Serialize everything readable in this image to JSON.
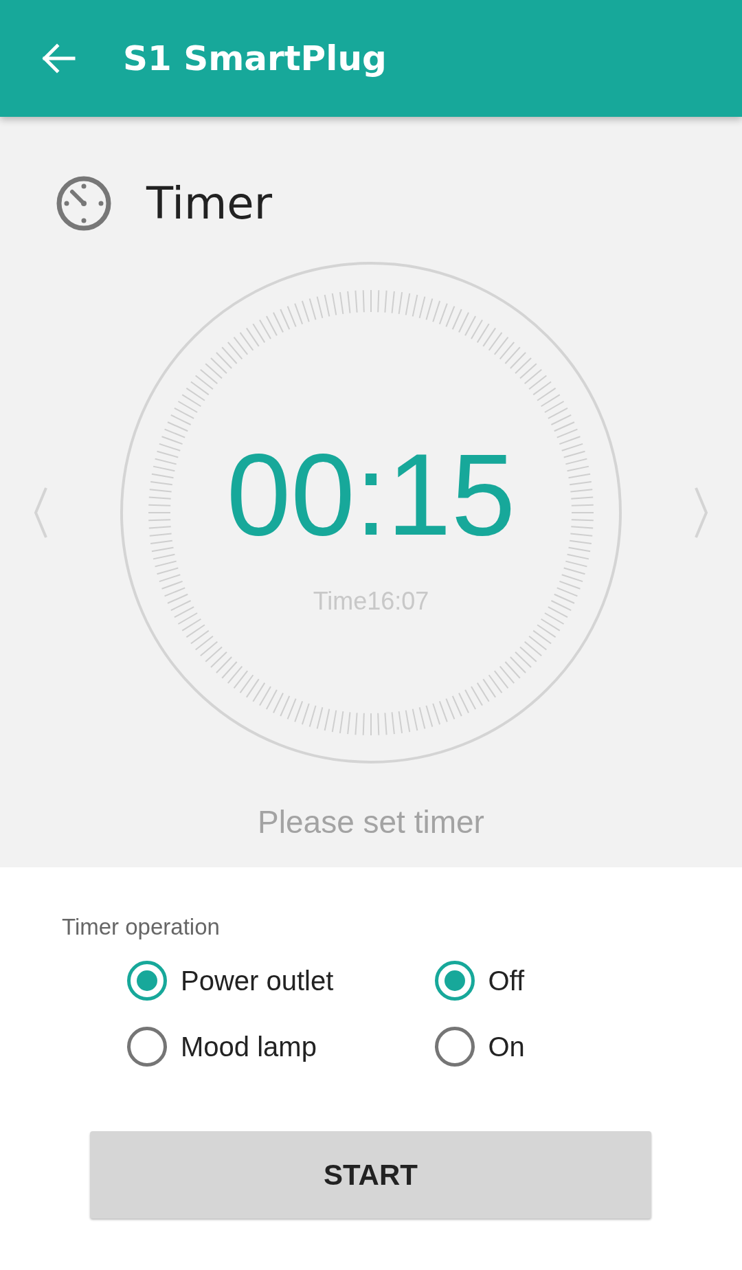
{
  "app_bar": {
    "title": "S1 SmartPlug"
  },
  "section": {
    "title": "Timer"
  },
  "timer": {
    "display": "00:15",
    "time": "Time16:07",
    "hint": "Please set timer"
  },
  "operation": {
    "label": "Timer operation",
    "groups": [
      {
        "options": [
          {
            "label": "Power outlet",
            "selected": true
          },
          {
            "label": "Mood lamp",
            "selected": false
          }
        ]
      },
      {
        "options": [
          {
            "label": "Off",
            "selected": true
          },
          {
            "label": "On",
            "selected": false
          }
        ]
      }
    ]
  },
  "button": {
    "label": "START"
  }
}
